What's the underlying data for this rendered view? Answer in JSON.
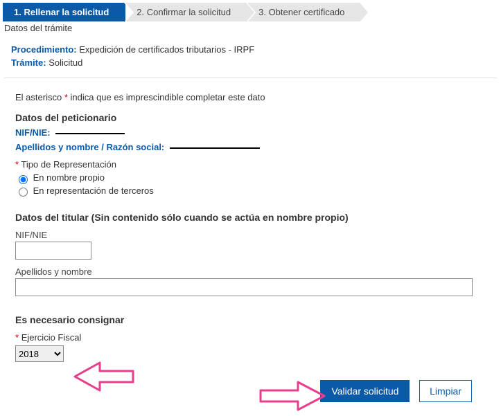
{
  "steps": {
    "s1": "1. Rellenar la solicitud",
    "s2": "2. Confirmar la solicitud",
    "s3": "3. Obtener certificado"
  },
  "tramite": {
    "section_title": "Datos del trámite",
    "proc_label": "Procedimiento:",
    "proc_value": "Expedición de certificados tributarios - IRPF",
    "tram_label": "Trámite:",
    "tram_value": "Solicitud"
  },
  "hint": {
    "pre": "El asterisco ",
    "mark": "*",
    "post": " indica que es imprescindible completar este dato"
  },
  "peticionario": {
    "heading": "Datos del peticionario",
    "nif_label": "NIF/NIE:",
    "name_label": "Apellidos y nombre / Razón social:",
    "tipo_label": "Tipo de Representación",
    "radio1": "En nombre propio",
    "radio2": "En representación de terceros"
  },
  "titular": {
    "heading": "Datos del titular (Sin contenido sólo cuando se actúa en nombre propio)",
    "nif_label": "NIF/NIE",
    "name_label": "Apellidos y nombre"
  },
  "consignar": {
    "heading": "Es necesario consignar",
    "ejercicio_label": "Ejercicio Fiscal",
    "year": "2018"
  },
  "buttons": {
    "validate": "Validar solicitud",
    "clear": "Limpiar"
  }
}
